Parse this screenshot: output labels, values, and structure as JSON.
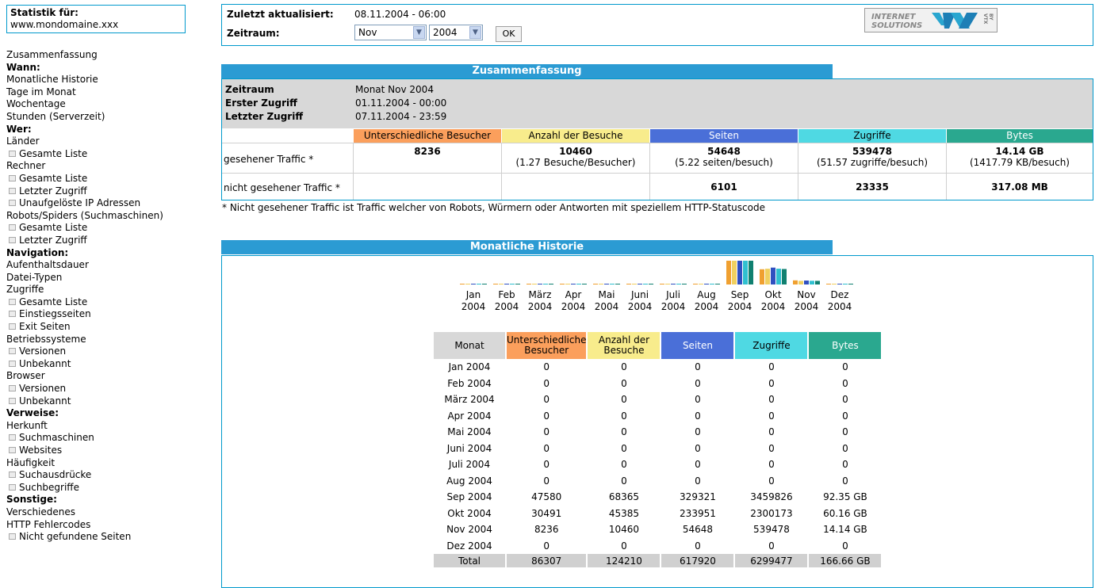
{
  "sidebar": {
    "stat_title": "Statistik für:",
    "domain": "www.mondomaine.xxx",
    "menu": [
      {
        "type": "item",
        "label": "Zusammenfassung"
      },
      {
        "type": "heading",
        "label": "Wann:"
      },
      {
        "type": "item",
        "label": "Monatliche Historie"
      },
      {
        "type": "item",
        "label": "Tage im Monat"
      },
      {
        "type": "item",
        "label": "Wochentage"
      },
      {
        "type": "item",
        "label": "Stunden (Serverzeit)"
      },
      {
        "type": "heading",
        "label": "Wer:"
      },
      {
        "type": "item",
        "label": "Länder"
      },
      {
        "type": "sub",
        "label": "Gesamte Liste"
      },
      {
        "type": "item",
        "label": "Rechner"
      },
      {
        "type": "sub",
        "label": "Gesamte Liste"
      },
      {
        "type": "sub",
        "label": "Letzter Zugriff"
      },
      {
        "type": "sub",
        "label": "Unaufgelöste IP Adressen"
      },
      {
        "type": "item",
        "label": "Robots/Spiders (Suchmaschinen)"
      },
      {
        "type": "sub",
        "label": "Gesamte Liste"
      },
      {
        "type": "sub",
        "label": "Letzter Zugriff"
      },
      {
        "type": "heading",
        "label": "Navigation:"
      },
      {
        "type": "item",
        "label": "Aufenthaltsdauer"
      },
      {
        "type": "item",
        "label": "Datei-Typen"
      },
      {
        "type": "item",
        "label": "Zugriffe"
      },
      {
        "type": "sub",
        "label": "Gesamte Liste"
      },
      {
        "type": "sub",
        "label": "Einstiegsseiten"
      },
      {
        "type": "sub",
        "label": "Exit Seiten"
      },
      {
        "type": "item",
        "label": "Betriebssysteme"
      },
      {
        "type": "sub",
        "label": "Versionen"
      },
      {
        "type": "sub",
        "label": "Unbekannt"
      },
      {
        "type": "item",
        "label": "Browser"
      },
      {
        "type": "sub",
        "label": "Versionen"
      },
      {
        "type": "sub",
        "label": "Unbekannt"
      },
      {
        "type": "heading",
        "label": "Verweise:"
      },
      {
        "type": "item",
        "label": "Herkunft"
      },
      {
        "type": "sub",
        "label": "Suchmaschinen"
      },
      {
        "type": "sub",
        "label": "Websites"
      },
      {
        "type": "item",
        "label": "Häufigkeit"
      },
      {
        "type": "sub",
        "label": "Suchausdrücke"
      },
      {
        "type": "sub",
        "label": "Suchbegriffe"
      },
      {
        "type": "heading",
        "label": "Sonstige:"
      },
      {
        "type": "item",
        "label": "Verschiedenes"
      },
      {
        "type": "item",
        "label": "HTTP Fehlercodes"
      },
      {
        "type": "sub",
        "label": "Nicht gefundene Seiten"
      }
    ]
  },
  "topbar": {
    "updated_label": "Zuletzt aktualisiert:",
    "updated_value": "08.11.2004 - 06:00",
    "period_label": "Zeitraum:",
    "month_select": "Nov",
    "year_select": "2004",
    "ok_label": "OK",
    "logo_line1": "INTERNET",
    "logo_line2": "SOLUTIONS",
    "logo_by": "BY VTX"
  },
  "summary": {
    "title": "Zusammenfassung",
    "rows": [
      {
        "label": "Zeitraum",
        "value": "Monat Nov 2004"
      },
      {
        "label": "Erster Zugriff",
        "value": "01.11.2004 - 00:00"
      },
      {
        "label": "Letzter Zugriff",
        "value": "07.11.2004 - 23:59"
      }
    ],
    "columns": [
      {
        "label": "Unterschiedliche Besucher",
        "color": "#fb9f5c"
      },
      {
        "label": "Anzahl der Besuche",
        "color": "#f8ec8c"
      },
      {
        "label": "Seiten",
        "color": "#4a6fd8"
      },
      {
        "label": "Zugriffe",
        "color": "#4fd9e3"
      },
      {
        "label": "Bytes",
        "color": "#2aa88f"
      }
    ],
    "seen": {
      "label": "gesehener Traffic *",
      "values": [
        "8236",
        "10460",
        "54648",
        "539478",
        "14.14 GB"
      ],
      "subs": [
        "",
        "(1.27 Besuche/Besucher)",
        "(5.22 seiten/besuch)",
        "(51.57 zugriffe/besuch)",
        "(1417.79 KB/besuch)"
      ]
    },
    "unseen": {
      "label": "nicht gesehener Traffic *",
      "values": [
        "",
        "",
        "6101",
        "23335",
        "317.08 MB"
      ]
    },
    "note": "* Nicht gesehener Traffic ist Traffic welcher von Robots, Würmern oder Antworten mit speziellem HTTP-Statuscode"
  },
  "history": {
    "title": "Monatliche Historie",
    "headers": [
      "Monat",
      "Unterschiedliche Besucher",
      "Anzahl der Besuche",
      "Seiten",
      "Zugriffe",
      "Bytes"
    ],
    "rows": [
      [
        "Jan 2004",
        "0",
        "0",
        "0",
        "0",
        "0"
      ],
      [
        "Feb 2004",
        "0",
        "0",
        "0",
        "0",
        "0"
      ],
      [
        "März 2004",
        "0",
        "0",
        "0",
        "0",
        "0"
      ],
      [
        "Apr 2004",
        "0",
        "0",
        "0",
        "0",
        "0"
      ],
      [
        "Mai 2004",
        "0",
        "0",
        "0",
        "0",
        "0"
      ],
      [
        "Juni 2004",
        "0",
        "0",
        "0",
        "0",
        "0"
      ],
      [
        "Juli 2004",
        "0",
        "0",
        "0",
        "0",
        "0"
      ],
      [
        "Aug 2004",
        "0",
        "0",
        "0",
        "0",
        "0"
      ],
      [
        "Sep 2004",
        "47580",
        "68365",
        "329321",
        "3459826",
        "92.35 GB"
      ],
      [
        "Okt 2004",
        "30491",
        "45385",
        "233951",
        "2300173",
        "60.16 GB"
      ],
      [
        "Nov 2004",
        "8236",
        "10460",
        "54648",
        "539478",
        "14.14 GB"
      ],
      [
        "Dez 2004",
        "0",
        "0",
        "0",
        "0",
        "0"
      ]
    ],
    "total": [
      "Total",
      "86307",
      "124210",
      "617920",
      "6299477",
      "166.66 GB"
    ]
  },
  "chart_data": {
    "type": "bar",
    "categories": [
      "Jan\n2004",
      "Feb\n2004",
      "März\n2004",
      "Apr\n2004",
      "Mai\n2004",
      "Juni\n2004",
      "Juli\n2004",
      "Aug\n2004",
      "Sep\n2004",
      "Okt\n2004",
      "Nov\n2004",
      "Dez\n2004"
    ],
    "series": [
      {
        "name": "Unterschiedliche Besucher",
        "color": "#f0a030",
        "values": [
          0,
          0,
          0,
          0,
          0,
          0,
          0,
          0,
          47580,
          30491,
          8236,
          0
        ]
      },
      {
        "name": "Anzahl der Besuche",
        "color": "#f0d060",
        "values": [
          0,
          0,
          0,
          0,
          0,
          0,
          0,
          0,
          68365,
          45385,
          10460,
          0
        ]
      },
      {
        "name": "Seiten",
        "color": "#3050c0",
        "values": [
          0,
          0,
          0,
          0,
          0,
          0,
          0,
          0,
          329321,
          233951,
          54648,
          0
        ]
      },
      {
        "name": "Zugriffe",
        "color": "#30c0d0",
        "values": [
          0,
          0,
          0,
          0,
          0,
          0,
          0,
          0,
          3459826,
          2300173,
          539478,
          0
        ]
      },
      {
        "name": "Bytes",
        "color": "#108070",
        "values": [
          0,
          0,
          0,
          0,
          0,
          0,
          0,
          0,
          92.35,
          60.16,
          14.14,
          0
        ]
      }
    ],
    "units": {
      "Bytes": "GB"
    }
  }
}
